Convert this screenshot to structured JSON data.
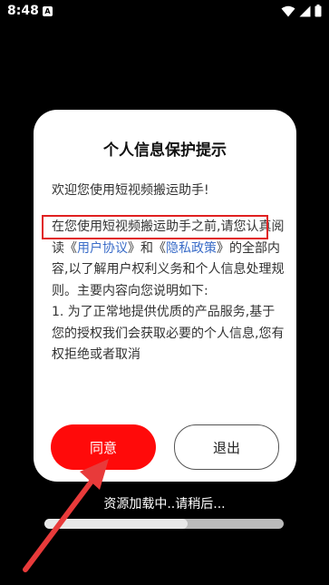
{
  "status_bar": {
    "time": "8:48",
    "notification_icon": "A"
  },
  "dialog": {
    "title": "个人信息保护提示",
    "welcome": "欢迎您使用短视频搬运助手!",
    "body": {
      "highlighted_intro": "在您使用短视频搬运助手之前,",
      "p1_a": "请您认真阅读《",
      "user_agreement_link": "用户协议",
      "p1_b": "》和《",
      "privacy_policy_link": "隐私政策",
      "p1_c": "》的全部内容,以了解用户权利义务和个人信息处理规则。主要内容向您说明如下:",
      "item1": "1. 为了正常地提供优质的产品服务,基于您的授权我们会获取必要的个人信息,您有权拒绝或者取消"
    },
    "agree_label": "同意",
    "exit_label": "退出"
  },
  "loading": {
    "text": "资源加载中..请稍后...",
    "progress": 0.6
  },
  "colors": {
    "accent": "#ff0a0a",
    "link": "#3a6cc8",
    "annotation": "#e02020"
  }
}
